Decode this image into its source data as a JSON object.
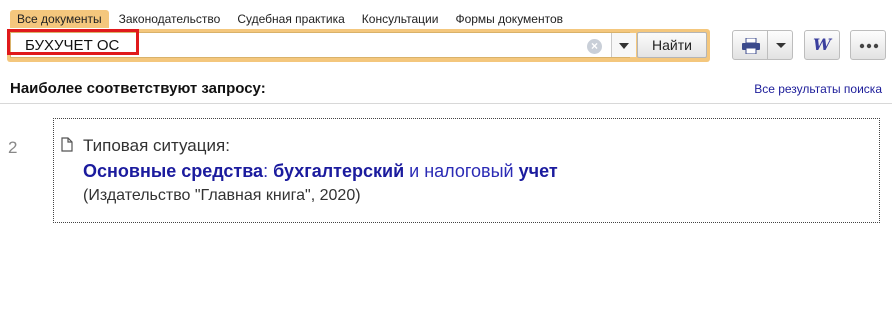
{
  "tabs": [
    {
      "label": "Все документы",
      "active": true
    },
    {
      "label": "Законодательство",
      "active": false
    },
    {
      "label": "Судебная практика",
      "active": false
    },
    {
      "label": "Консультации",
      "active": false
    },
    {
      "label": "Формы документов",
      "active": false
    }
  ],
  "search": {
    "value": "БУХУЧЕТ ОС",
    "find_label": "Найти"
  },
  "toolbar": {
    "print_icon": "printer-icon",
    "word_icon": "word-export-icon",
    "word_glyph": "W",
    "more_icon": "more-icon"
  },
  "results": {
    "heading": "Наиболее соответствуют запросу:",
    "all_results_link": "Все результаты поиска",
    "items": [
      {
        "number": "2",
        "type": "Типовая ситуация:",
        "title_parts": [
          {
            "text": "Основные средства",
            "hl": true
          },
          {
            "text": ": ",
            "hl": false
          },
          {
            "text": "бухгалтерский",
            "hl": true
          },
          {
            "text": " и налоговый ",
            "hl": false
          },
          {
            "text": "учет",
            "hl": true
          }
        ],
        "source": "(Издательство \"Главная книга\", 2020)"
      }
    ]
  },
  "colors": {
    "accent": "#f4c77d",
    "highlight_border": "#e0191b",
    "link": "#1b1b9e"
  }
}
